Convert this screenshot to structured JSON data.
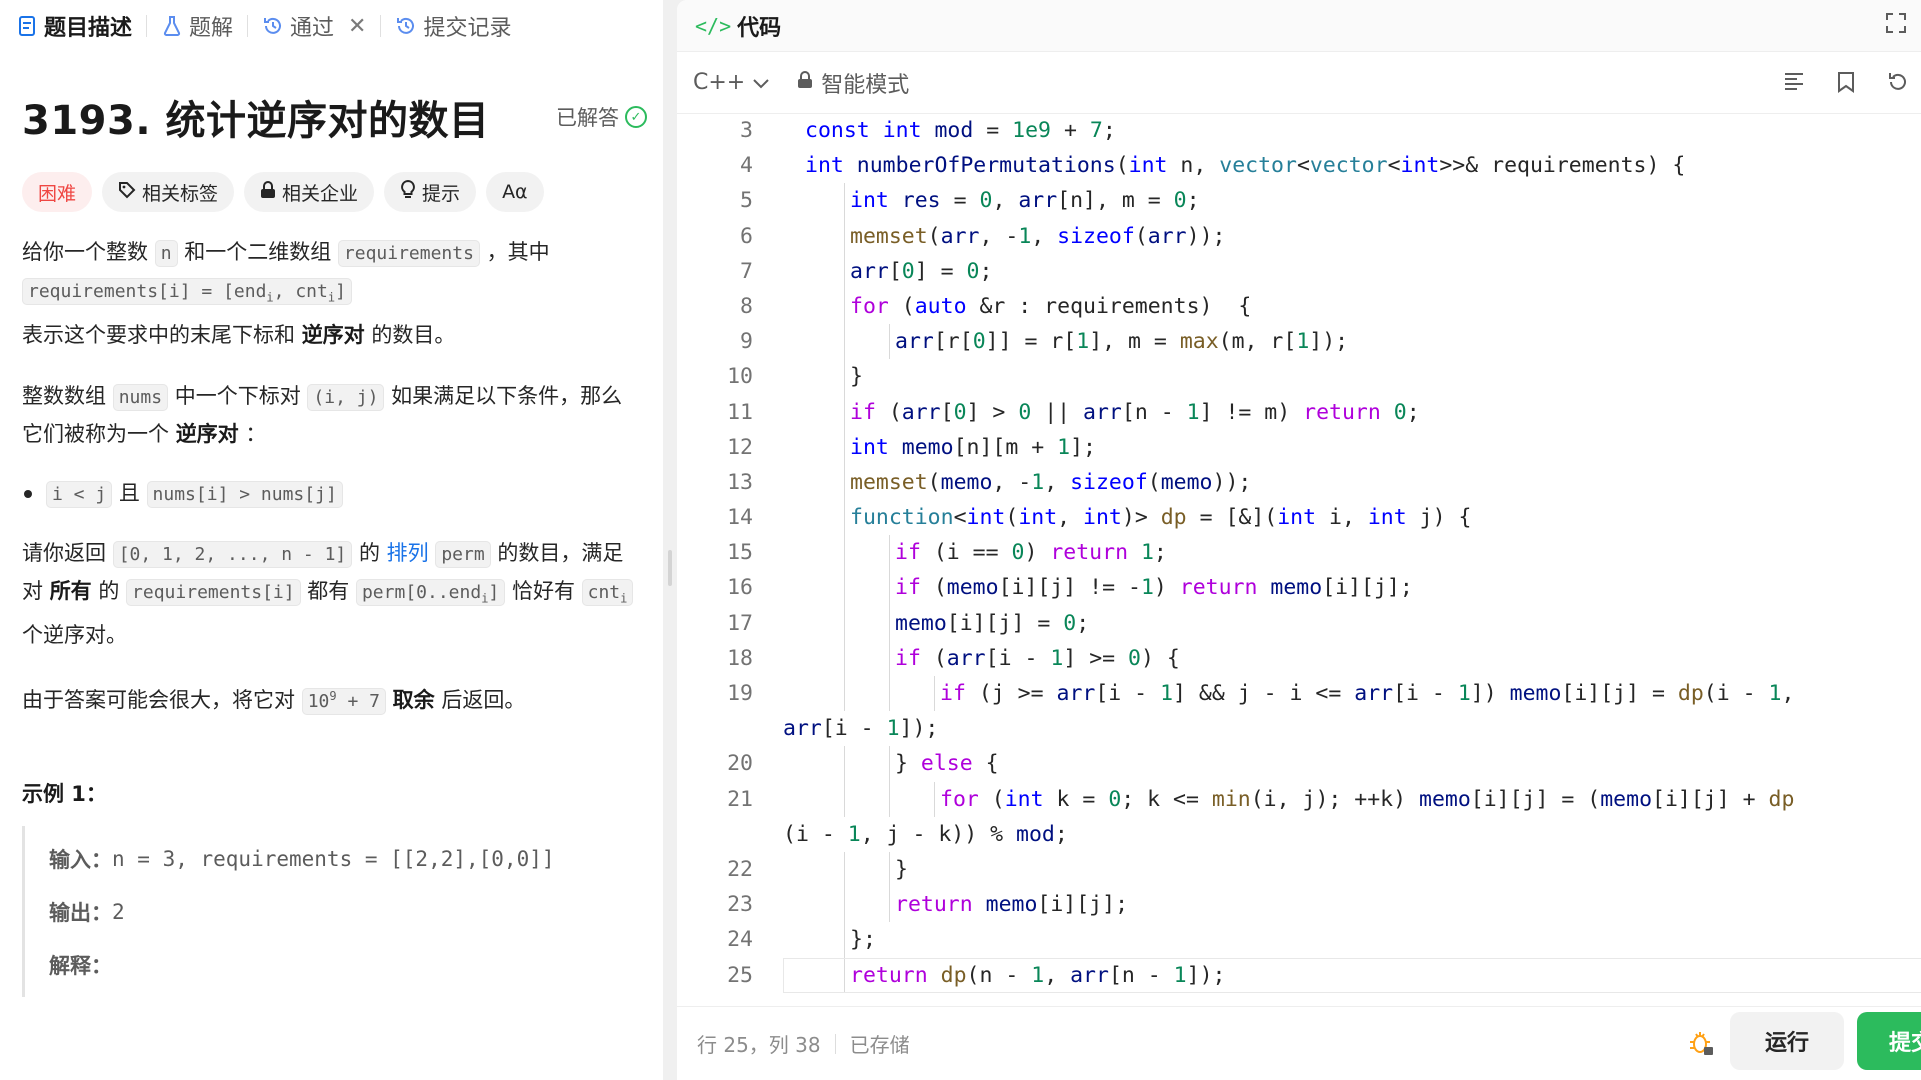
{
  "left": {
    "tabs": [
      {
        "label": "题目描述"
      },
      {
        "label": "题解"
      },
      {
        "label": "通过"
      },
      {
        "label": "提交记录"
      }
    ],
    "title": "3193. 统计逆序对的数目",
    "solved_label": "已解答",
    "tags": {
      "difficulty": "困难",
      "related_tags": "相关标签",
      "related_companies": "相关企业",
      "hint": "提示",
      "font": "Aα"
    },
    "desc": {
      "p1_a": "给你一个整数 ",
      "p1_n": "n",
      "p1_b": " 和一个二维数组 ",
      "p1_req": "requirements",
      "p1_c": " ，其中 ",
      "p1_req2": "requirements[i] = [end",
      "p1_sub1": "i",
      "p1_mid": ", cnt",
      "p1_sub2": "i",
      "p1_end": "]",
      "p1_d": "表示这个要求中的末尾下标和 ",
      "p1_b1": "逆序对",
      "p1_e": " 的数目。",
      "p2_a": "整数数组 ",
      "p2_nums": "nums",
      "p2_b": " 中一个下标对 ",
      "p2_ij": "(i, j)",
      "p2_c": " 如果满足以下条件，那么它们被称为一个 ",
      "p2_b1": "逆序对",
      "p2_d": " ：",
      "li_a": "i < j",
      "li_b": " 且 ",
      "li_c": "nums[i] > nums[j]",
      "p3_a": "请你返回 ",
      "p3_arr": "[0, 1, 2, ..., n - 1]",
      "p3_b": " 的 ",
      "p3_link": "排列",
      "p3_perm": "perm",
      "p3_c": " 的数目，满足对 ",
      "p3_all": "所有",
      "p3_d": " 的 ",
      "p3_reqi": "requirements[i]",
      "p3_e": " 都有 ",
      "p3_perm2": "perm[0..end",
      "p3_sub": "i",
      "p3_perm2e": "]",
      "p3_f": " 恰好有 ",
      "p3_cnt": "cnt",
      "p3_cntsub": "i",
      "p3_g": " 个逆序对。",
      "p4_a": "由于答案可能会很大，将它对 ",
      "p4_mod": "10",
      "p4_sup": "9",
      "p4_mod2": " + 7",
      "p4_b": " ",
      "p4_bold": "取余",
      "p4_c": " 后返回。"
    },
    "example": {
      "title": "示例 1：",
      "input_label": "输入：",
      "input_value": "n = 3, requirements = [[2,2],[0,0]]",
      "output_label": "输出：",
      "output_value": "2",
      "explain_label": "解释："
    }
  },
  "right": {
    "header_label": "代码",
    "language": "C++",
    "mode": "智能模式",
    "status_position": "行 25，列 38",
    "status_saved": "已存储",
    "run_label": "运行",
    "submit_label": "提交"
  },
  "code_lines": [
    {
      "n": "3",
      "indent": 1,
      "code": "const int mod = 1e9 + 7;"
    },
    {
      "n": "4",
      "indent": 1,
      "code": "int numberOfPermutations(int n, vector<vector<int>>& requirements) {"
    },
    {
      "n": "5",
      "indent": 2,
      "code": "int res = 0, arr[n], m = 0;"
    },
    {
      "n": "6",
      "indent": 2,
      "code": "memset(arr, -1, sizeof(arr));"
    },
    {
      "n": "7",
      "indent": 2,
      "code": "arr[0] = 0;"
    },
    {
      "n": "8",
      "indent": 2,
      "code": "for (auto &r : requirements)  {"
    },
    {
      "n": "9",
      "indent": 3,
      "code": "arr[r[0]] = r[1], m = max(m, r[1]);"
    },
    {
      "n": "10",
      "indent": 2,
      "code": "}"
    },
    {
      "n": "11",
      "indent": 2,
      "code": "if (arr[0] > 0 || arr[n - 1] != m) return 0;"
    },
    {
      "n": "12",
      "indent": 2,
      "code": "int memo[n][m + 1];"
    },
    {
      "n": "13",
      "indent": 2,
      "code": "memset(memo, -1, sizeof(memo));"
    },
    {
      "n": "14",
      "indent": 2,
      "code": "function<int(int, int)> dp = [&](int i, int j) {"
    },
    {
      "n": "15",
      "indent": 3,
      "code": "if (i == 0) return 1;"
    },
    {
      "n": "16",
      "indent": 3,
      "code": "if (memo[i][j] != -1) return memo[i][j];"
    },
    {
      "n": "17",
      "indent": 3,
      "code": "memo[i][j] = 0;"
    },
    {
      "n": "18",
      "indent": 3,
      "code": "if (arr[i - 1] >= 0) {"
    },
    {
      "n": "19",
      "indent": 4,
      "code": "if (j >= arr[i - 1] && j - i <= arr[i - 1]) memo[i][j] = dp(i - 1,"
    },
    {
      "n": "",
      "indent": 0,
      "code": "arr[i - 1]);"
    },
    {
      "n": "20",
      "indent": 3,
      "code": "} else {"
    },
    {
      "n": "21",
      "indent": 4,
      "code": "for (int k = 0; k <= min(i, j); ++k) memo[i][j] = (memo[i][j] + dp"
    },
    {
      "n": "",
      "indent": 0,
      "code": "(i - 1, j - k)) % mod;"
    },
    {
      "n": "22",
      "indent": 3,
      "code": "}"
    },
    {
      "n": "23",
      "indent": 3,
      "code": "return memo[i][j];"
    },
    {
      "n": "24",
      "indent": 2,
      "code": "};"
    },
    {
      "n": "25",
      "indent": 2,
      "code": "return dp(n - 1, arr[n - 1]);"
    }
  ],
  "colors": {
    "accent_green": "#2cbb5d",
    "hard_red": "#ef4743",
    "link_blue": "#1a73e8"
  }
}
